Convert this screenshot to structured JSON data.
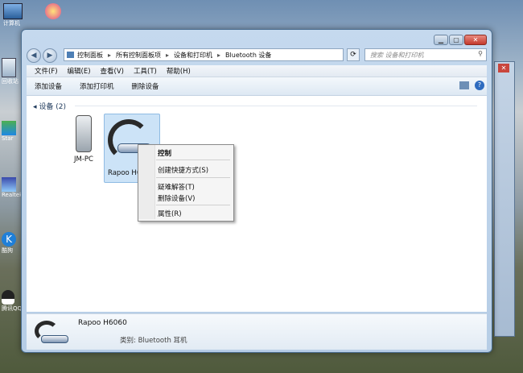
{
  "desktop": {
    "icons": [
      {
        "label": "计算机"
      },
      {
        "label": "回收站"
      },
      {
        "label": "Star"
      },
      {
        "label": "Realtek"
      },
      {
        "label": "酷狗"
      },
      {
        "label": "腾讯QQ"
      }
    ]
  },
  "window": {
    "address": [
      "控制面板",
      "所有控制面板项",
      "设备和打印机",
      "Bluetooth 设备"
    ],
    "search_placeholder": "搜索 设备和打印机",
    "menu": [
      "文件(F)",
      "编辑(E)",
      "查看(V)",
      "工具(T)",
      "帮助(H)"
    ],
    "toolbar": [
      "添加设备",
      "添加打印机",
      "删除设备"
    ],
    "group_label": "设备 (2)",
    "devices": [
      {
        "label": "JM-PC"
      },
      {
        "label": "Rapoo H60"
      }
    ],
    "context_menu": {
      "items": [
        "控制",
        "创建快捷方式(S)",
        "疑难解答(T)",
        "删除设备(V)",
        "属性(R)"
      ]
    },
    "details": {
      "name": "Rapoo H6060",
      "category": "类别: Bluetooth 耳机"
    }
  },
  "colors": {
    "accent": "#2b5c91",
    "selection": "#cce3f7"
  }
}
